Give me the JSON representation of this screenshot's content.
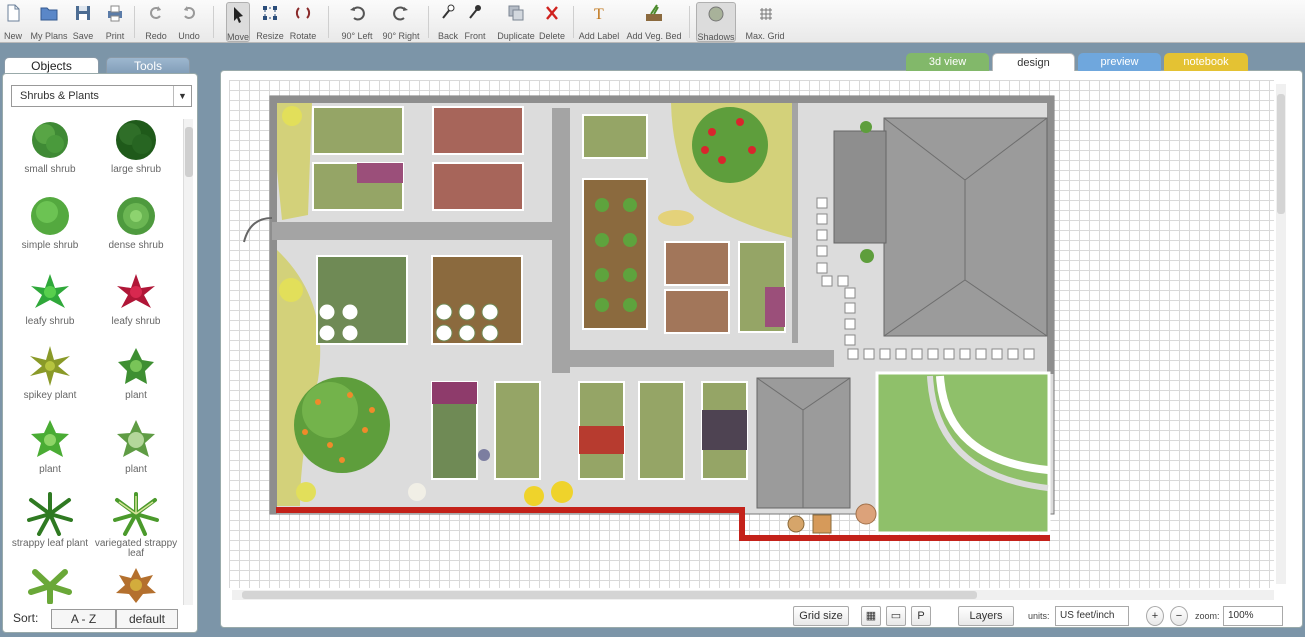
{
  "toolbar": {
    "new": "New",
    "my_plans": "My Plans",
    "save": "Save",
    "print": "Print",
    "redo": "Redo",
    "undo": "Undo",
    "move": "Move",
    "resize": "Resize",
    "rotate": "Rotate",
    "rot_left": "90° Left",
    "rot_right": "90° Right",
    "back": "Back",
    "front": "Front",
    "duplicate": "Duplicate",
    "delete": "Delete",
    "add_label": "Add Label",
    "add_veg_bed": "Add Veg. Bed",
    "shadows": "Shadows",
    "max_grid": "Max. Grid"
  },
  "left_panel": {
    "tabs": [
      "Objects",
      "Tools"
    ],
    "category": "Shrubs & Plants",
    "items": [
      "small shrub",
      "large shrub",
      "simple shrub",
      "dense shrub",
      "leafy shrub",
      "leafy shrub",
      "spikey plant",
      "plant",
      "plant",
      "plant",
      "strappy leaf plant",
      "variegated strappy leaf",
      "",
      ""
    ],
    "sort_label": "Sort:",
    "sort_az": "A - Z",
    "sort_default": "default"
  },
  "view_tabs": [
    "3d view",
    "design",
    "preview",
    "notebook"
  ],
  "status": {
    "grid_size": "Grid size",
    "layers": "Layers",
    "units_label": "units:",
    "units_value": "US feet/inch",
    "zoom_label": "zoom:",
    "zoom_value": "100%",
    "p": "P"
  },
  "colors": {
    "lawn": "#8fc06a",
    "path": "#dcdcdc",
    "wall": "#9a9a9a",
    "brick": "#c4221a",
    "meadow": "#d3d17a",
    "roof": "#9b9b9b",
    "tab_3d": "#82b86a",
    "tab_preview": "#6fa7dd",
    "tab_notebook": "#e4c233"
  }
}
